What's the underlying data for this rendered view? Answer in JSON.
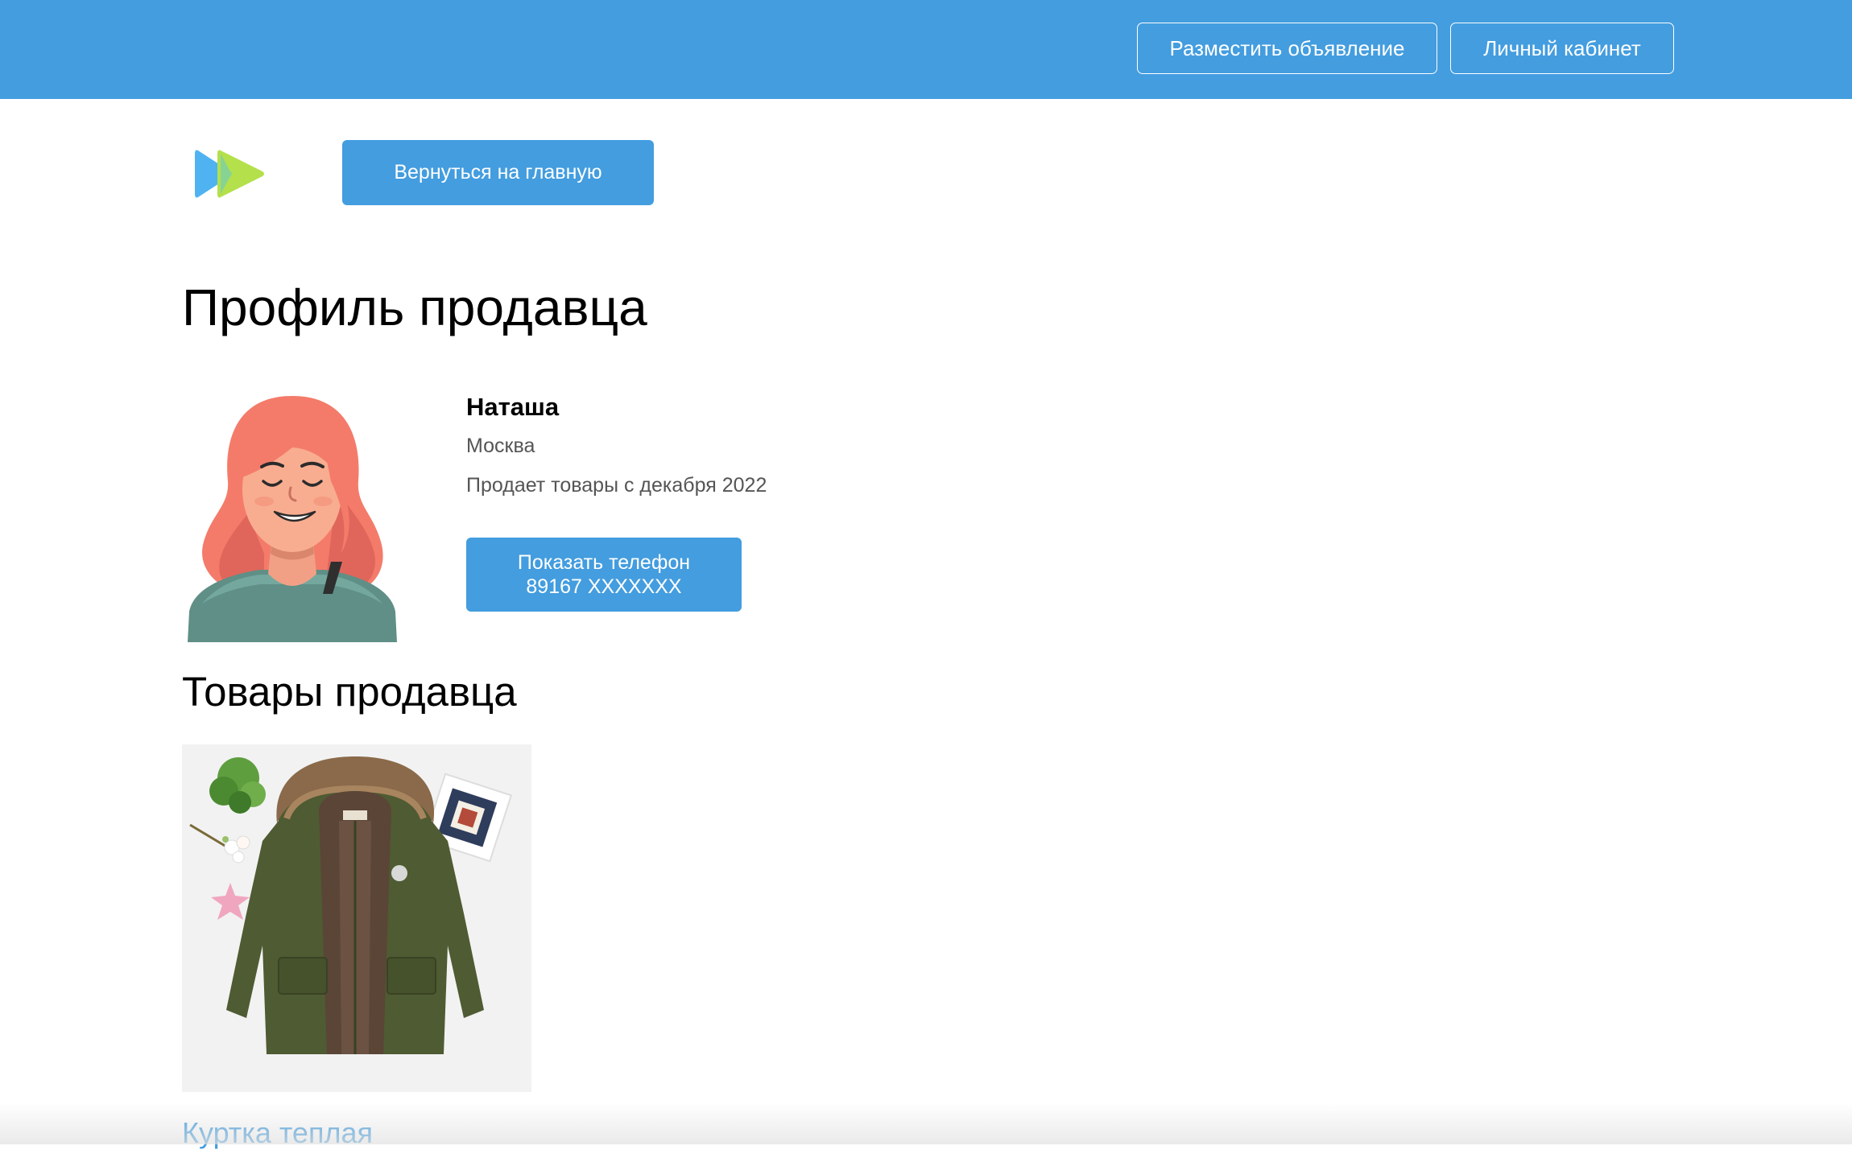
{
  "header": {
    "post_ad_label": "Разместить объявление",
    "cabinet_label": "Личный кабинет",
    "accent_color": "#439ddf"
  },
  "nav": {
    "logo_icon": "play-forward-logo-icon",
    "back_label": "Вернуться на главную"
  },
  "profile": {
    "title": "Профиль продавца",
    "avatar_icon": "seller-avatar-illustration",
    "name": "Наташа",
    "city": "Москва",
    "since": "Продает товары с декабря 2022",
    "phone_label": "Показать телефон",
    "phone_number": "89167 XXXXXXX"
  },
  "goods": {
    "title": "Товары продавца",
    "items": [
      {
        "name": "Куртка теплая",
        "image_icon": "jacket-photo"
      }
    ]
  }
}
